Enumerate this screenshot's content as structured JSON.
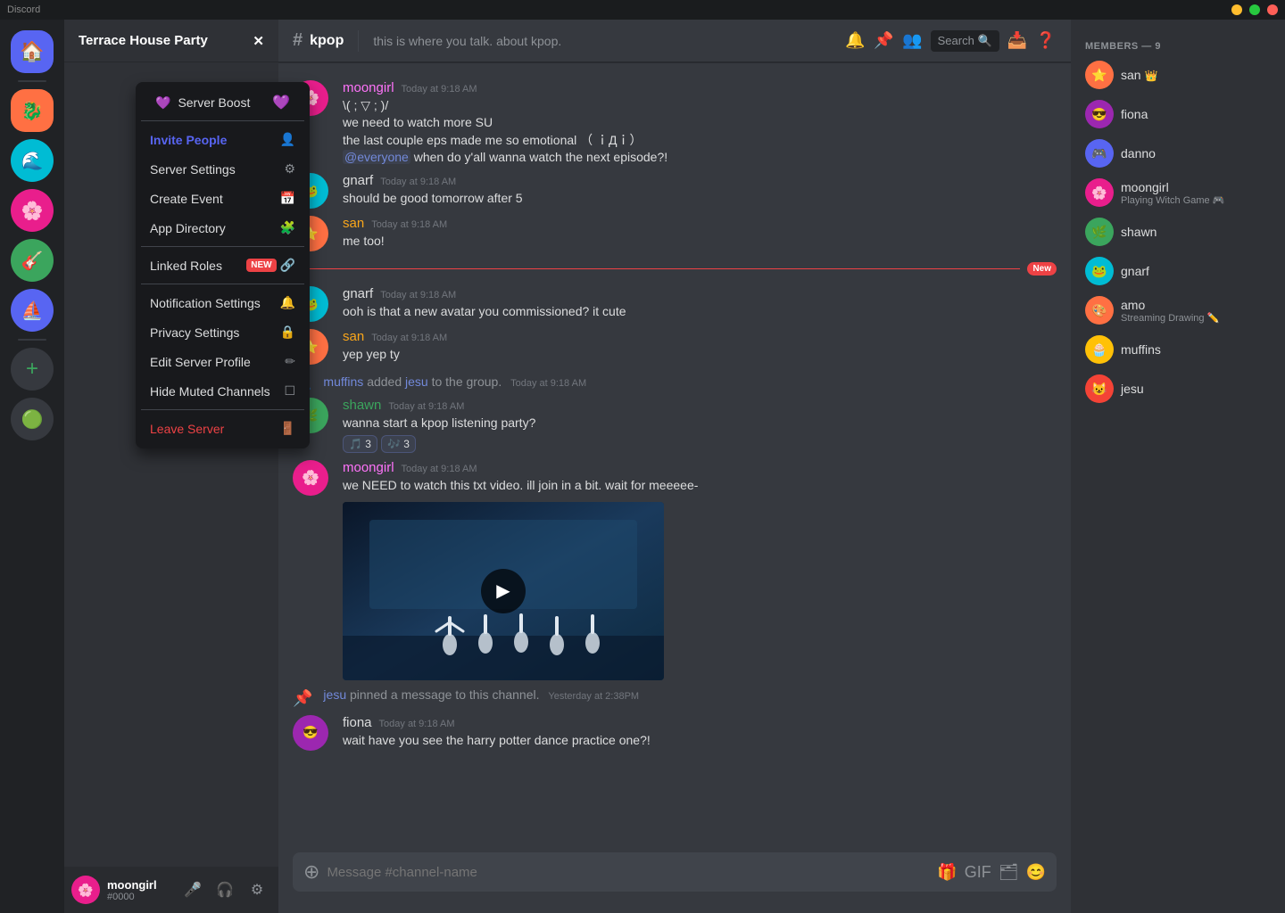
{
  "titlebar": {
    "title": "Discord",
    "min": "—",
    "max": "□",
    "close": "✕"
  },
  "server": {
    "name": "Terrace House Party",
    "chevron": "▾"
  },
  "channel": {
    "name": "kpop",
    "topic": "this is where you talk. about kpop.",
    "hash": "#"
  },
  "contextMenu": {
    "items": [
      {
        "label": "Server Boost",
        "icon": "💜",
        "type": "normal",
        "badge": null
      },
      {
        "label": "Invite People",
        "icon": "👤+",
        "type": "highlight",
        "badge": null
      },
      {
        "label": "Server Settings",
        "icon": "⚙",
        "type": "normal",
        "badge": null
      },
      {
        "label": "Create Event",
        "icon": "📅",
        "type": "normal",
        "badge": null
      },
      {
        "label": "App Directory",
        "icon": "🧩",
        "type": "normal",
        "badge": null
      },
      {
        "label": "Linked Roles",
        "icon": "🔗",
        "type": "normal",
        "badge": "NEW"
      },
      {
        "label": "Notification Settings",
        "icon": "🔔",
        "type": "normal",
        "badge": null
      },
      {
        "label": "Privacy Settings",
        "icon": "🔒",
        "type": "normal",
        "badge": null
      },
      {
        "label": "Edit Server Profile",
        "icon": "✏",
        "type": "normal",
        "badge": null
      },
      {
        "label": "Hide Muted Channels",
        "icon": "☐",
        "type": "normal",
        "badge": null
      },
      {
        "label": "Leave Server",
        "icon": "🚪",
        "type": "danger",
        "badge": null
      }
    ]
  },
  "messages": [
    {
      "id": "msg1",
      "user": "moongirl",
      "color": "#ff73fa",
      "avatarBg": "#e91e8c",
      "timestamp": "Today at 9:18 AM",
      "lines": [
        "\\( ; ▽ ; )/",
        "we need to watch more SU",
        "the last couple eps made me so emotional （ ｉДｉ）",
        "@everyone when do y'all wanna watch the next episode?!"
      ],
      "hasMention": true
    },
    {
      "id": "msg2",
      "user": "gnarf",
      "color": "#dcddde",
      "avatarBg": "#5865f2",
      "timestamp": "Today at 9:18 AM",
      "lines": [
        "should be good tomorrow after 5"
      ],
      "hasMention": false
    },
    {
      "id": "msg3",
      "user": "san",
      "color": "#faa61a",
      "avatarBg": "#ff7043",
      "timestamp": "Today at 9:18 AM",
      "lines": [
        "me too!"
      ],
      "hasMention": false
    },
    {
      "id": "msg4",
      "user": "gnarf",
      "color": "#dcddde",
      "avatarBg": "#5865f2",
      "timestamp": "Today at 9:18 AM",
      "lines": [
        "ooh is that a new avatar you commissioned? it cute"
      ],
      "hasMention": false,
      "isNew": true
    },
    {
      "id": "msg5",
      "user": "san",
      "color": "#faa61a",
      "avatarBg": "#ff7043",
      "timestamp": "Today at 9:18 AM",
      "lines": [
        "yep yep ty"
      ],
      "hasMention": false
    },
    {
      "id": "sys1",
      "type": "system",
      "text": "muffins added jesu to the group.",
      "timestamp": "Today at 9:18 AM"
    },
    {
      "id": "msg6",
      "user": "shawn",
      "color": "#3ba55d",
      "avatarBg": "#3ba55d",
      "timestamp": "Today at 9:18 AM",
      "lines": [
        "wanna start a kpop listening party?"
      ],
      "hasMention": false,
      "reactions": [
        {
          "emoji": "🎵",
          "count": 3
        },
        {
          "emoji": "🎶",
          "count": 3
        }
      ]
    },
    {
      "id": "msg7",
      "user": "moongirl",
      "color": "#ff73fa",
      "avatarBg": "#e91e8c",
      "timestamp": "Today at 9:18 AM",
      "lines": [
        "we NEED to watch this txt video. ill join in a bit. wait for meeeee-"
      ],
      "hasMention": false,
      "hasVideo": true
    },
    {
      "id": "pin1",
      "type": "pin",
      "user": "jesu",
      "timestamp": "Yesterday at 2:38PM",
      "text": "pinned a message to this channel."
    },
    {
      "id": "msg8",
      "user": "fiona",
      "color": "#dcddde",
      "avatarBg": "#9c27b0",
      "timestamp": "Today at 9:18 AM",
      "lines": [
        "wait have you see the harry potter dance practice one?!"
      ],
      "hasMention": false
    }
  ],
  "members": {
    "header": "MEMBERS — 9",
    "list": [
      {
        "name": "san",
        "hasCrown": true,
        "avatarBg": "#ff7043",
        "status": null
      },
      {
        "name": "fiona",
        "hasCrown": false,
        "avatarBg": "#9c27b0",
        "status": null
      },
      {
        "name": "danno",
        "hasCrown": false,
        "avatarBg": "#5865f2",
        "status": null
      },
      {
        "name": "moongirl",
        "hasCrown": false,
        "avatarBg": "#e91e8c",
        "status": "Playing Witch Game 🎮"
      },
      {
        "name": "shawn",
        "hasCrown": false,
        "avatarBg": "#3ba55d",
        "status": null
      },
      {
        "name": "gnarf",
        "hasCrown": false,
        "avatarBg": "#00bcd4",
        "status": null
      },
      {
        "name": "amo",
        "hasCrown": false,
        "avatarBg": "#ff7043",
        "status": "Streaming Drawing 🖊️"
      },
      {
        "name": "muffins",
        "hasCrown": false,
        "avatarBg": "#ffc107",
        "status": null
      },
      {
        "name": "jesu",
        "hasCrown": false,
        "avatarBg": "#f44336",
        "status": null
      }
    ]
  },
  "user": {
    "name": "moongirl",
    "discriminator": "#0000",
    "avatarBg": "#e91e8c"
  },
  "search": {
    "placeholder": "Search"
  },
  "inputPlaceholder": "Message #channel-name",
  "serverIcons": [
    {
      "id": "discord-home",
      "emoji": "🏠",
      "bg": "#5865f2"
    },
    {
      "id": "server1",
      "emoji": "🐉",
      "bg": "#ff7043"
    },
    {
      "id": "server2",
      "emoji": "🌊",
      "bg": "#00bcd4"
    },
    {
      "id": "server3",
      "emoji": "🌸",
      "bg": "#e91e8c"
    },
    {
      "id": "server4",
      "emoji": "🎸",
      "bg": "#3ba55d"
    },
    {
      "id": "server5",
      "emoji": "⛵",
      "bg": "#5865f2"
    },
    {
      "id": "server6",
      "emoji": "🟢",
      "bg": "#3ba55d"
    }
  ]
}
